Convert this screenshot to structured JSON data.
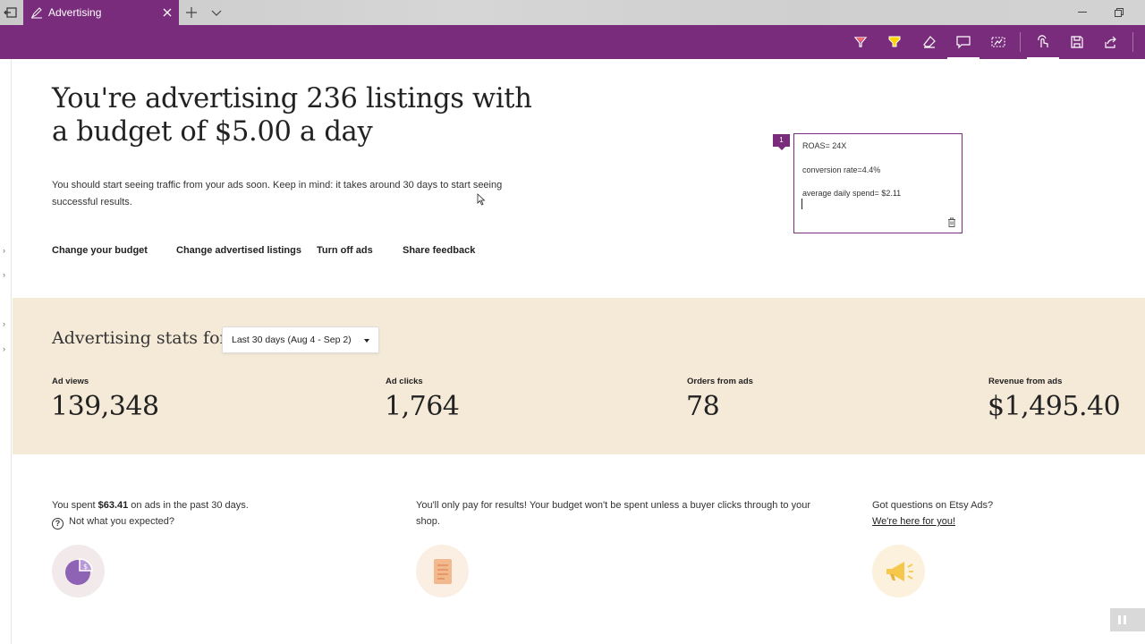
{
  "browser": {
    "tab_title": "Advertising",
    "icons": [
      "back-icon",
      "pen-icon",
      "close-icon",
      "plus-icon",
      "chevron-down-icon",
      "minimize-icon",
      "restore-icon"
    ]
  },
  "toolbar": {
    "icons": [
      "ballpoint-pen-icon",
      "highlighter-icon",
      "eraser-icon",
      "add-note-icon",
      "clip-icon",
      "touch-write-icon",
      "save-icon",
      "share-icon"
    ],
    "colors": {
      "bar": "#7a2c7c",
      "pen": "#ff6a6a",
      "highlighter": "#ffd400"
    }
  },
  "page": {
    "headline": "You're advertising 236 listings with a budget of $5.00 a day",
    "subtext": "You should start seeing traffic from your ads soon. Keep in mind: it takes around 30 days to start seeing successful results.",
    "actions": [
      "Change your budget",
      "Change advertised listings",
      "Turn off ads",
      "Share feedback"
    ]
  },
  "note": {
    "marker": "1",
    "lines": [
      "ROAS= 24X",
      "conversion rate=4.4%",
      "average daily spend= $2.11"
    ]
  },
  "stats": {
    "title": "Advertising stats for",
    "range": "Last 30 days (Aug 4 - Sep 2)",
    "items": [
      {
        "label": "Ad views",
        "value": "139,348"
      },
      {
        "label": "Ad clicks",
        "value": "1,764"
      },
      {
        "label": "Orders from ads",
        "value": "78"
      },
      {
        "label": "Revenue from ads",
        "value": "$1,495.40"
      }
    ],
    "background": "#f5ead8"
  },
  "info": {
    "spent_prefix": "You spent ",
    "spent_amount": "$63.41",
    "spent_suffix": " on ads in the past 30 days.",
    "not_expected": "Not what you expected?",
    "pay_results": "You'll only pay for results! Your budget won't be spent unless a buyer clicks through to your shop.",
    "questions": "Got questions on Etsy Ads?",
    "here_for_you": "We're here for you!"
  }
}
